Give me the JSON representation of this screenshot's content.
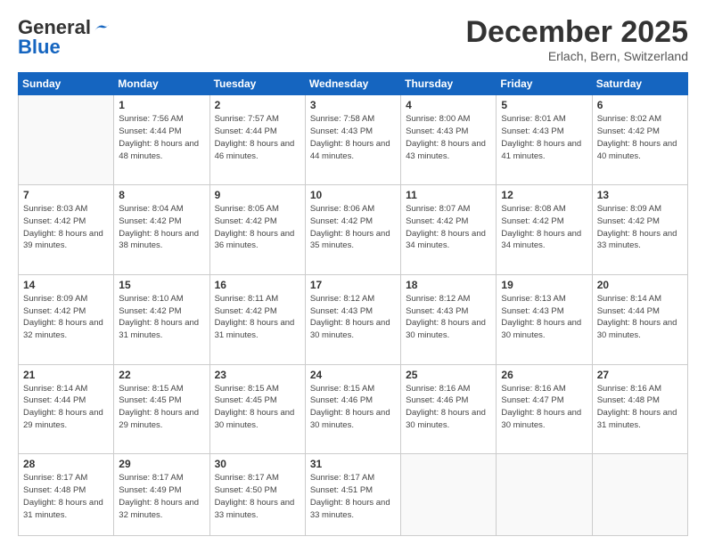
{
  "logo": {
    "general": "General",
    "blue": "Blue"
  },
  "header": {
    "month": "December 2025",
    "location": "Erlach, Bern, Switzerland"
  },
  "weekdays": [
    "Sunday",
    "Monday",
    "Tuesday",
    "Wednesday",
    "Thursday",
    "Friday",
    "Saturday"
  ],
  "weeks": [
    [
      {
        "day": null
      },
      {
        "day": "1",
        "sunrise": "7:56 AM",
        "sunset": "4:44 PM",
        "daylight": "8 hours and 48 minutes."
      },
      {
        "day": "2",
        "sunrise": "7:57 AM",
        "sunset": "4:44 PM",
        "daylight": "8 hours and 46 minutes."
      },
      {
        "day": "3",
        "sunrise": "7:58 AM",
        "sunset": "4:43 PM",
        "daylight": "8 hours and 44 minutes."
      },
      {
        "day": "4",
        "sunrise": "8:00 AM",
        "sunset": "4:43 PM",
        "daylight": "8 hours and 43 minutes."
      },
      {
        "day": "5",
        "sunrise": "8:01 AM",
        "sunset": "4:43 PM",
        "daylight": "8 hours and 41 minutes."
      },
      {
        "day": "6",
        "sunrise": "8:02 AM",
        "sunset": "4:42 PM",
        "daylight": "8 hours and 40 minutes."
      }
    ],
    [
      {
        "day": "7",
        "sunrise": "8:03 AM",
        "sunset": "4:42 PM",
        "daylight": "8 hours and 39 minutes."
      },
      {
        "day": "8",
        "sunrise": "8:04 AM",
        "sunset": "4:42 PM",
        "daylight": "8 hours and 38 minutes."
      },
      {
        "day": "9",
        "sunrise": "8:05 AM",
        "sunset": "4:42 PM",
        "daylight": "8 hours and 36 minutes."
      },
      {
        "day": "10",
        "sunrise": "8:06 AM",
        "sunset": "4:42 PM",
        "daylight": "8 hours and 35 minutes."
      },
      {
        "day": "11",
        "sunrise": "8:07 AM",
        "sunset": "4:42 PM",
        "daylight": "8 hours and 34 minutes."
      },
      {
        "day": "12",
        "sunrise": "8:08 AM",
        "sunset": "4:42 PM",
        "daylight": "8 hours and 34 minutes."
      },
      {
        "day": "13",
        "sunrise": "8:09 AM",
        "sunset": "4:42 PM",
        "daylight": "8 hours and 33 minutes."
      }
    ],
    [
      {
        "day": "14",
        "sunrise": "8:09 AM",
        "sunset": "4:42 PM",
        "daylight": "8 hours and 32 minutes."
      },
      {
        "day": "15",
        "sunrise": "8:10 AM",
        "sunset": "4:42 PM",
        "daylight": "8 hours and 31 minutes."
      },
      {
        "day": "16",
        "sunrise": "8:11 AM",
        "sunset": "4:42 PM",
        "daylight": "8 hours and 31 minutes."
      },
      {
        "day": "17",
        "sunrise": "8:12 AM",
        "sunset": "4:43 PM",
        "daylight": "8 hours and 30 minutes."
      },
      {
        "day": "18",
        "sunrise": "8:12 AM",
        "sunset": "4:43 PM",
        "daylight": "8 hours and 30 minutes."
      },
      {
        "day": "19",
        "sunrise": "8:13 AM",
        "sunset": "4:43 PM",
        "daylight": "8 hours and 30 minutes."
      },
      {
        "day": "20",
        "sunrise": "8:14 AM",
        "sunset": "4:44 PM",
        "daylight": "8 hours and 30 minutes."
      }
    ],
    [
      {
        "day": "21",
        "sunrise": "8:14 AM",
        "sunset": "4:44 PM",
        "daylight": "8 hours and 29 minutes."
      },
      {
        "day": "22",
        "sunrise": "8:15 AM",
        "sunset": "4:45 PM",
        "daylight": "8 hours and 29 minutes."
      },
      {
        "day": "23",
        "sunrise": "8:15 AM",
        "sunset": "4:45 PM",
        "daylight": "8 hours and 30 minutes."
      },
      {
        "day": "24",
        "sunrise": "8:15 AM",
        "sunset": "4:46 PM",
        "daylight": "8 hours and 30 minutes."
      },
      {
        "day": "25",
        "sunrise": "8:16 AM",
        "sunset": "4:46 PM",
        "daylight": "8 hours and 30 minutes."
      },
      {
        "day": "26",
        "sunrise": "8:16 AM",
        "sunset": "4:47 PM",
        "daylight": "8 hours and 30 minutes."
      },
      {
        "day": "27",
        "sunrise": "8:16 AM",
        "sunset": "4:48 PM",
        "daylight": "8 hours and 31 minutes."
      }
    ],
    [
      {
        "day": "28",
        "sunrise": "8:17 AM",
        "sunset": "4:48 PM",
        "daylight": "8 hours and 31 minutes."
      },
      {
        "day": "29",
        "sunrise": "8:17 AM",
        "sunset": "4:49 PM",
        "daylight": "8 hours and 32 minutes."
      },
      {
        "day": "30",
        "sunrise": "8:17 AM",
        "sunset": "4:50 PM",
        "daylight": "8 hours and 33 minutes."
      },
      {
        "day": "31",
        "sunrise": "8:17 AM",
        "sunset": "4:51 PM",
        "daylight": "8 hours and 33 minutes."
      },
      {
        "day": null
      },
      {
        "day": null
      },
      {
        "day": null
      }
    ]
  ]
}
